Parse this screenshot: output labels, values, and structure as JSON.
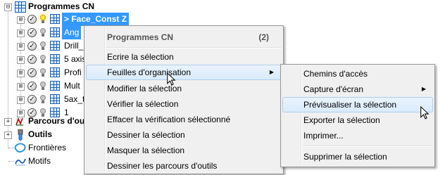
{
  "tree": {
    "root": {
      "label": "Programmes CN",
      "expander": "⊟"
    },
    "items": [
      {
        "label": "> Face_Const Z",
        "expander": "⊞",
        "state": "active"
      },
      {
        "label": "Ang",
        "expander": "⊞",
        "state": "selected"
      },
      {
        "label": "Drill_",
        "expander": "⊞",
        "state": "normal"
      },
      {
        "label": "5 axis",
        "expander": "⊞",
        "state": "normal"
      },
      {
        "label": "Profi",
        "expander": "⊞",
        "state": "normal"
      },
      {
        "label": "Mult",
        "expander": "⊞",
        "state": "normal"
      },
      {
        "label": "5ax_t",
        "expander": "⊞",
        "state": "normal"
      },
      {
        "label": "1",
        "expander": "⊞",
        "state": "normal"
      }
    ],
    "sections": [
      {
        "label": "Parcours d'outi",
        "bold": true
      },
      {
        "label": "Outils",
        "bold": true
      },
      {
        "label": "Frontières",
        "bold": false
      },
      {
        "label": "Motifs",
        "bold": false
      }
    ]
  },
  "context_menu": {
    "header": "Programmes CN",
    "count": "(2)",
    "items": [
      {
        "label": "Ecrire la sélection"
      },
      {
        "label": "Feuilles d'organisation",
        "submenu": true,
        "hover": true
      },
      {
        "label": "Modifier la sélection"
      },
      {
        "label": "Vérifier la sélection"
      },
      {
        "label": "Effacer la vérification sélectionné"
      },
      {
        "label": "Dessiner la sélection"
      },
      {
        "label": "Masquer la sélection"
      },
      {
        "label": "Dessiner les parcours d'outils"
      }
    ]
  },
  "submenu": {
    "items": [
      {
        "label": "Chemins d'accès"
      },
      {
        "label": "Capture d'écran",
        "submenu": true
      },
      {
        "label": "Prévisualiser la sélection",
        "hover": true
      },
      {
        "label": "Exporter la sélection"
      },
      {
        "label": "Imprimer..."
      },
      {
        "label": "Supprimer la sélection"
      }
    ]
  },
  "colors": {
    "selection": "#3399ff",
    "menu_bg": "#f0f0f0",
    "hover_border": "#aeceee",
    "icon_blue": "#1a5fb4"
  }
}
